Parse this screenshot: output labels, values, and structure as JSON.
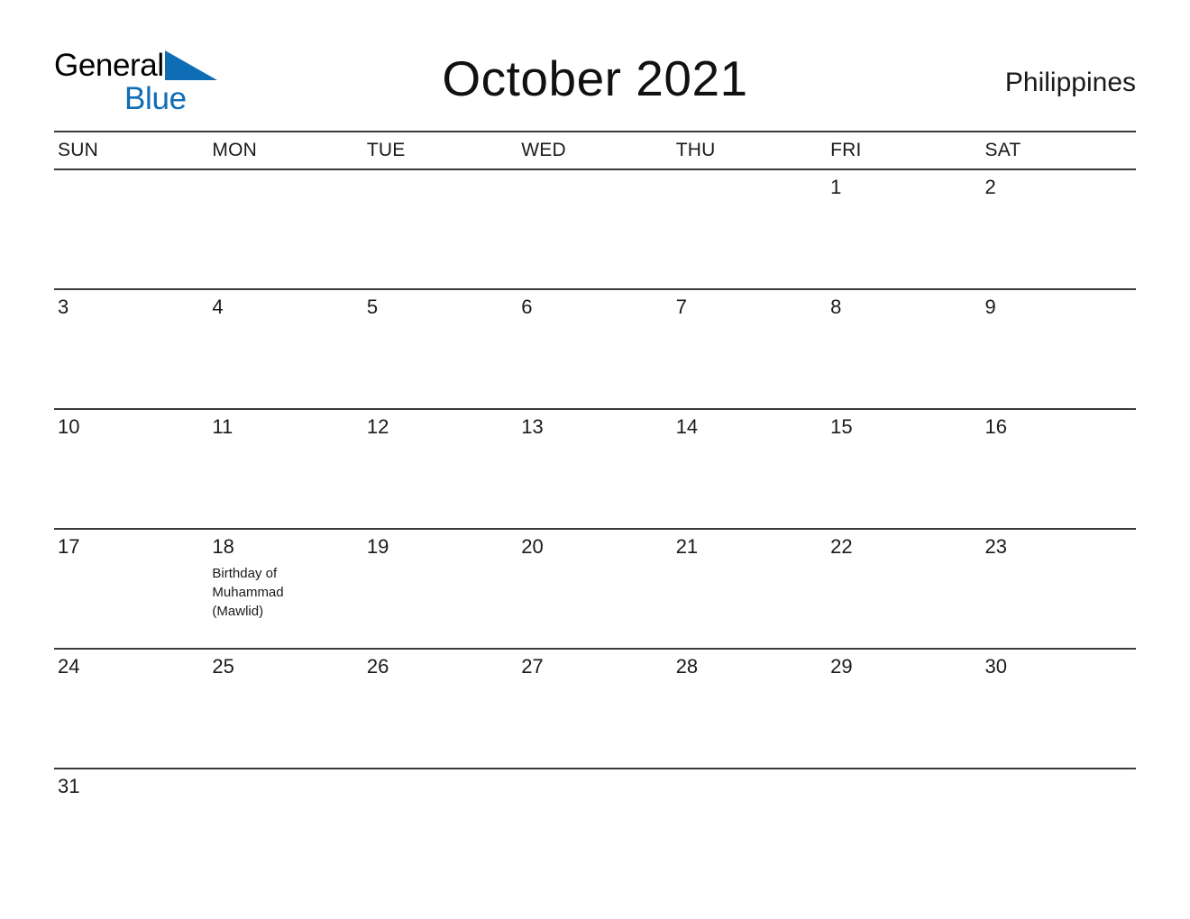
{
  "brand": {
    "name_top": "General",
    "name_bottom": "Blue",
    "triangle_icon": "blue-triangle-icon",
    "accent_color": "#0E6DB5",
    "text_color": "#000000"
  },
  "header": {
    "title": "October 2021",
    "country": "Philippines"
  },
  "calendar": {
    "month": "October",
    "year": "2021",
    "weekday_headers": [
      "SUN",
      "MON",
      "TUE",
      "WED",
      "THU",
      "FRI",
      "SAT"
    ],
    "weeks": [
      [
        {
          "day": "",
          "event": ""
        },
        {
          "day": "",
          "event": ""
        },
        {
          "day": "",
          "event": ""
        },
        {
          "day": "",
          "event": ""
        },
        {
          "day": "",
          "event": ""
        },
        {
          "day": "1",
          "event": ""
        },
        {
          "day": "2",
          "event": ""
        }
      ],
      [
        {
          "day": "3",
          "event": ""
        },
        {
          "day": "4",
          "event": ""
        },
        {
          "day": "5",
          "event": ""
        },
        {
          "day": "6",
          "event": ""
        },
        {
          "day": "7",
          "event": ""
        },
        {
          "day": "8",
          "event": ""
        },
        {
          "day": "9",
          "event": ""
        }
      ],
      [
        {
          "day": "10",
          "event": ""
        },
        {
          "day": "11",
          "event": ""
        },
        {
          "day": "12",
          "event": ""
        },
        {
          "day": "13",
          "event": ""
        },
        {
          "day": "14",
          "event": ""
        },
        {
          "day": "15",
          "event": ""
        },
        {
          "day": "16",
          "event": ""
        }
      ],
      [
        {
          "day": "17",
          "event": ""
        },
        {
          "day": "18",
          "event": "Birthday of Muhammad (Mawlid)"
        },
        {
          "day": "19",
          "event": ""
        },
        {
          "day": "20",
          "event": ""
        },
        {
          "day": "21",
          "event": ""
        },
        {
          "day": "22",
          "event": ""
        },
        {
          "day": "23",
          "event": ""
        }
      ],
      [
        {
          "day": "24",
          "event": ""
        },
        {
          "day": "25",
          "event": ""
        },
        {
          "day": "26",
          "event": ""
        },
        {
          "day": "27",
          "event": ""
        },
        {
          "day": "28",
          "event": ""
        },
        {
          "day": "29",
          "event": ""
        },
        {
          "day": "30",
          "event": ""
        }
      ],
      [
        {
          "day": "31",
          "event": ""
        },
        {
          "day": "",
          "event": ""
        },
        {
          "day": "",
          "event": ""
        },
        {
          "day": "",
          "event": ""
        },
        {
          "day": "",
          "event": ""
        },
        {
          "day": "",
          "event": ""
        },
        {
          "day": "",
          "event": ""
        }
      ]
    ]
  }
}
